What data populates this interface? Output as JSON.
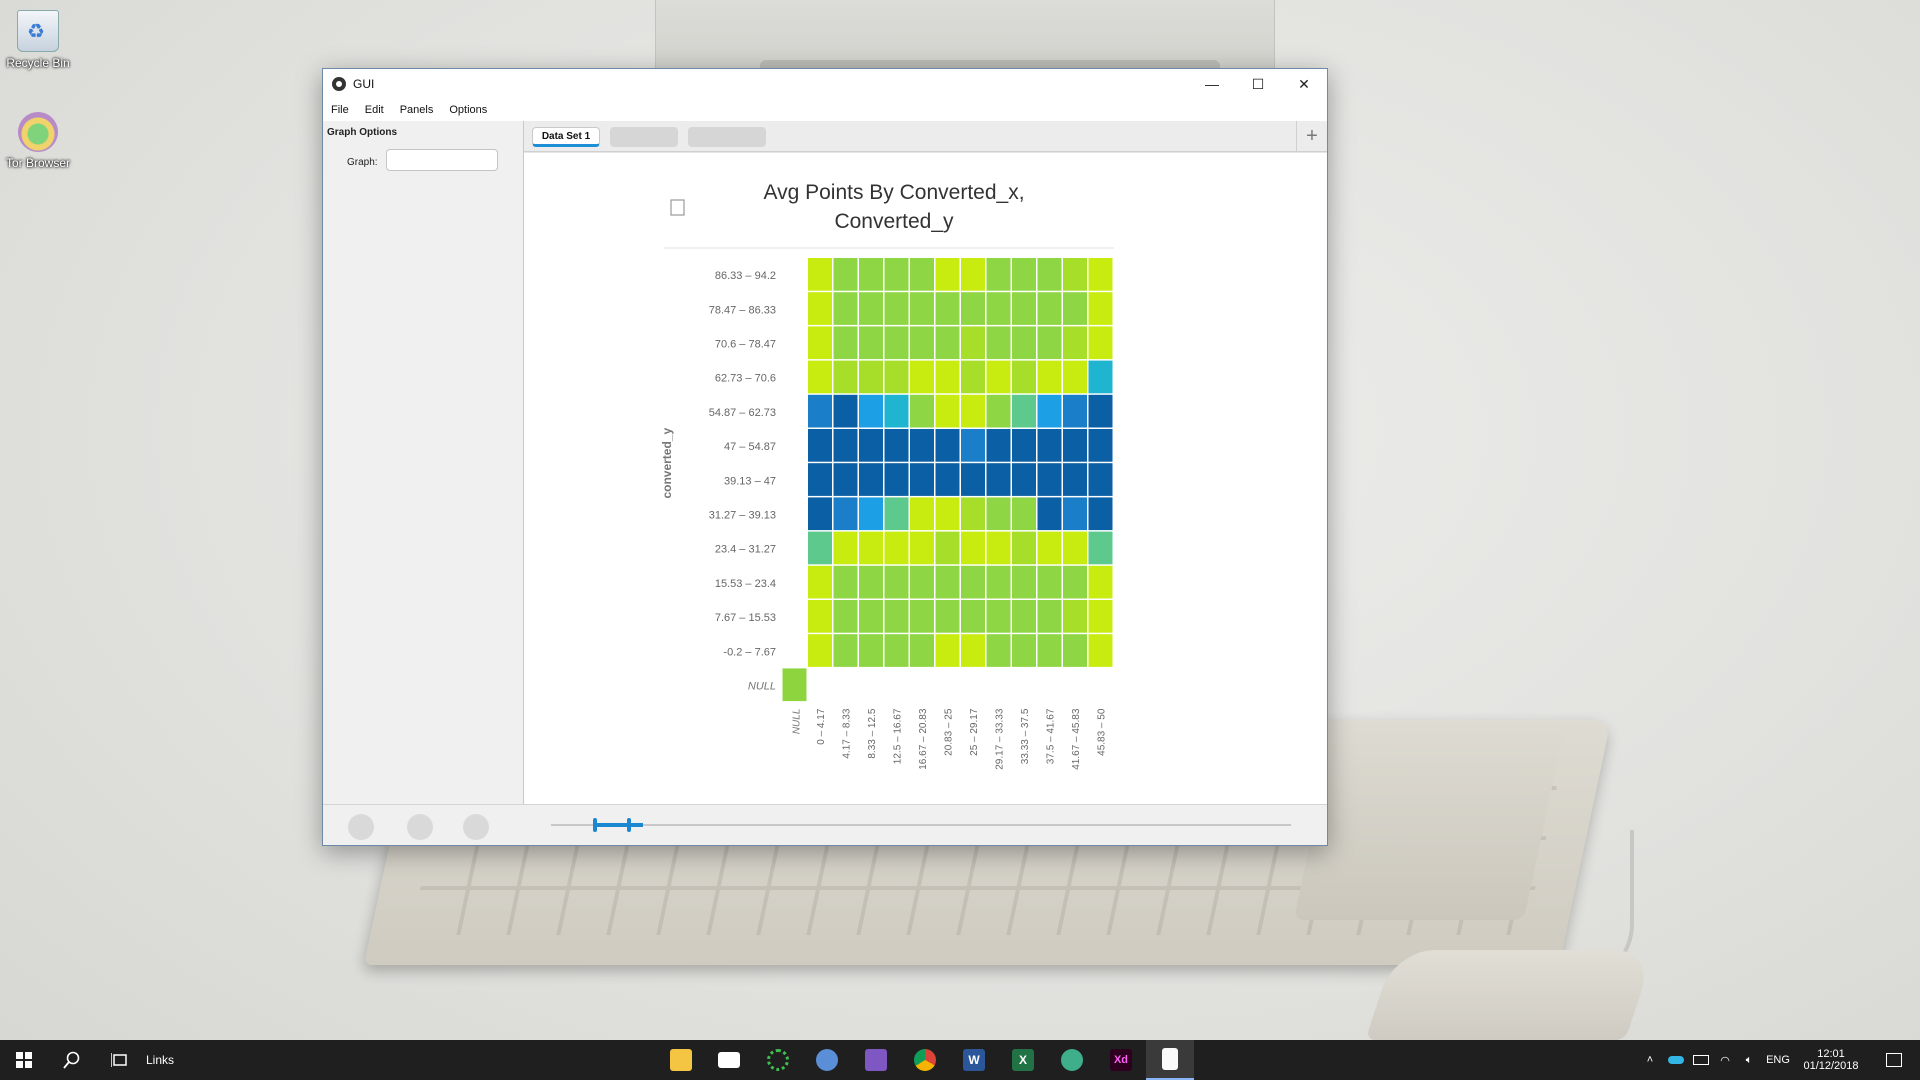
{
  "desktop": {
    "icons": [
      {
        "label": "Recycle Bin"
      },
      {
        "label": "Tor Browser"
      }
    ]
  },
  "window": {
    "title": "GUI",
    "controls": {
      "minimize": "—",
      "maximize": "☐",
      "close": "✕"
    },
    "menu": [
      "File",
      "Edit",
      "Panels",
      "Options"
    ],
    "left_panel": {
      "title": "Graph Options",
      "graph_label": "Graph:",
      "graph_value": ""
    },
    "tabs": [
      {
        "label": "Data Set 1",
        "active": true
      },
      {
        "label": "",
        "active": false
      },
      {
        "label": "",
        "active": false
      }
    ],
    "add_tab": "+",
    "bottom": {
      "slider_range": [
        0.06,
        0.12
      ]
    }
  },
  "chart_data": {
    "type": "heatmap",
    "title": "Avg Points By Converted_x,",
    "title_line2": "Converted_y",
    "ylabel": "converted_y",
    "x_categories": [
      "0 – 4.17",
      "4.17 – 8.33",
      "8.33 – 12.5",
      "12.5 – 16.67",
      "16.67 – 20.83",
      "20.83 – 25",
      "25 – 29.17",
      "29.17 – 33.33",
      "33.33 – 37.5",
      "37.5 – 41.67",
      "41.67 – 45.83",
      "45.83 – 50"
    ],
    "y_categories": [
      "86.33 – 94.2",
      "78.47 – 86.33",
      "70.6 – 78.47",
      "62.73 – 70.6",
      "54.87 – 62.73",
      "47 – 54.87",
      "39.13 – 47",
      "31.27 – 39.13",
      "23.4 – 31.27",
      "15.53 – 23.4",
      "7.67 – 15.53",
      "-0.2 – 7.67"
    ],
    "null_label": "NULL",
    "palette": {
      "1": "#c9ec10",
      "2": "#a6de2a",
      "3": "#8fd645",
      "4": "#5dc98d",
      "5": "#1fb5d0",
      "6": "#1d9fe6",
      "7": "#1a7fc8",
      "8": "#0b5fa5",
      "null": "#8dd43f"
    },
    "levels": [
      [
        1,
        3,
        3,
        3,
        3,
        1,
        1,
        3,
        3,
        3,
        2,
        1
      ],
      [
        1,
        3,
        3,
        3,
        3,
        3,
        3,
        3,
        3,
        3,
        3,
        1
      ],
      [
        1,
        3,
        3,
        3,
        3,
        3,
        2,
        3,
        3,
        3,
        2,
        1
      ],
      [
        1,
        2,
        2,
        2,
        1,
        1,
        2,
        1,
        2,
        1,
        1,
        5
      ],
      [
        7,
        8,
        6,
        5,
        3,
        1,
        1,
        3,
        4,
        6,
        7,
        8
      ],
      [
        8,
        8,
        8,
        8,
        8,
        8,
        7,
        8,
        8,
        8,
        8,
        8
      ],
      [
        8,
        8,
        8,
        8,
        8,
        8,
        8,
        8,
        8,
        8,
        8,
        8
      ],
      [
        8,
        7,
        6,
        4,
        1,
        1,
        2,
        3,
        3,
        8,
        7,
        8
      ],
      [
        4,
        1,
        1,
        1,
        1,
        2,
        1,
        1,
        2,
        1,
        1,
        4
      ],
      [
        1,
        3,
        3,
        3,
        3,
        3,
        3,
        3,
        3,
        3,
        3,
        1
      ],
      [
        1,
        3,
        3,
        3,
        3,
        3,
        3,
        3,
        3,
        3,
        2,
        1
      ],
      [
        1,
        3,
        3,
        3,
        3,
        1,
        1,
        3,
        3,
        3,
        3,
        1
      ]
    ]
  },
  "taskbar": {
    "search_label": "Links",
    "apps": [
      "file-explorer",
      "mail",
      "spinner",
      "r-studio",
      "visual-studio",
      "chrome",
      "word",
      "excel",
      "app-green",
      "adobe-xd",
      "notepad"
    ],
    "xd_label": "Xd",
    "word_label": "W",
    "excel_label": "X",
    "lang": "ENG",
    "time": "12:01",
    "date": "01/12/2018"
  }
}
